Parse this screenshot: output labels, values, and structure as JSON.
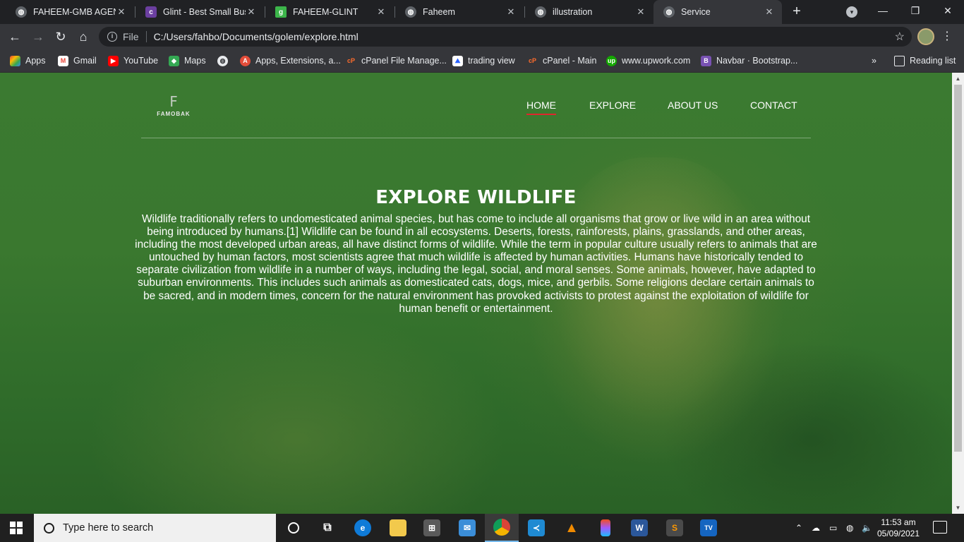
{
  "browser": {
    "tabs": [
      {
        "title": "FAHEEM-GMB AGENCY",
        "fav_color": "#5f6368",
        "fav_glyph": ""
      },
      {
        "title": "Glint - Best Small Business",
        "fav_color": "#6b3fa0",
        "fav_glyph": ""
      },
      {
        "title": "FAHEEM-GLINT",
        "fav_color": "#3cb54a",
        "fav_glyph": "g"
      },
      {
        "title": "Faheem",
        "fav_color": "#5f6368",
        "fav_glyph": ""
      },
      {
        "title": "illustration",
        "fav_color": "#5f6368",
        "fav_glyph": ""
      },
      {
        "title": "Service",
        "fav_color": "#5f6368",
        "fav_glyph": ""
      }
    ],
    "active_tab": 5,
    "address": {
      "scheme_label": "File",
      "url": "C:/Users/fahbo/Documents/golem/explore.html"
    },
    "bookmarks": [
      {
        "label": "Apps",
        "icon": "apps-grid-icon",
        "color": "#e94235"
      },
      {
        "label": "Gmail",
        "icon": "gmail-icon",
        "color": "#ea4335"
      },
      {
        "label": "YouTube",
        "icon": "youtube-icon",
        "color": "#ff0000"
      },
      {
        "label": "Maps",
        "icon": "maps-icon",
        "color": "#34a853"
      },
      {
        "label": "",
        "icon": "globe-icon",
        "color": "#5f6368"
      },
      {
        "label": "Apps, Extensions, a...",
        "icon": "extensions-icon",
        "color": "#e44d3a"
      },
      {
        "label": "cPanel File Manage...",
        "icon": "cpanel-icon",
        "color": "#ff6c2c"
      },
      {
        "label": "trading view",
        "icon": "trading-view-icon",
        "color": "#2962ff"
      },
      {
        "label": "cPanel - Main",
        "icon": "cpanel-icon",
        "color": "#ff6c2c"
      },
      {
        "label": "www.upwork.com",
        "icon": "upwork-icon",
        "color": "#14a800"
      },
      {
        "label": "Navbar · Bootstrap...",
        "icon": "bootstrap-icon",
        "color": "#7952b3"
      }
    ],
    "reading_list": "Reading list"
  },
  "site": {
    "logo_mark": "F",
    "logo_text": "FAMOBAK",
    "nav": [
      {
        "label": "HOME",
        "active": true
      },
      {
        "label": "EXPLORE",
        "active": false
      },
      {
        "label": "ABOUT US",
        "active": false
      },
      {
        "label": "CONTACT",
        "active": false
      }
    ],
    "accent_color": "#e0252d",
    "overlay_color": "#3b7a31",
    "hero": {
      "title": "EXPLORE WILDLIFE",
      "text": "Wildlife traditionally refers to undomesticated animal species, but has come to include all organisms that grow or live wild in an area without being introduced by humans.[1] Wildlife can be found in all ecosystems. Deserts, forests, rainforests, plains, grasslands, and other areas, including the most developed urban areas, all have distinct forms of wildlife. While the term in popular culture usually refers to animals that are untouched by human factors, most scientists agree that much wildlife is affected by human activities. Humans have historically tended to separate civilization from wildlife in a number of ways, including the legal, social, and moral senses. Some animals, however, have adapted to suburban environments. This includes such animals as domesticated cats, dogs, mice, and gerbils. Some religions declare certain animals to be sacred, and in modern times, concern for the natural environment has provoked activists to protest against the exploitation of wildlife for human benefit or entertainment."
    }
  },
  "taskbar": {
    "search_placeholder": "Type here to search",
    "apps": [
      {
        "name": "cortana-icon",
        "color": "#202020"
      },
      {
        "name": "task-view-icon",
        "color": "#202020"
      },
      {
        "name": "edge-icon",
        "color": "#0f7bd8"
      },
      {
        "name": "file-explorer-icon",
        "color": "#f2c94c"
      },
      {
        "name": "store-icon",
        "color": "#5a5a5a"
      },
      {
        "name": "mail-icon",
        "color": "#3b8ed8"
      },
      {
        "name": "chrome-icon",
        "color": "#db4437"
      },
      {
        "name": "vscode-icon",
        "color": "#1f8ad2"
      },
      {
        "name": "vlc-icon",
        "color": "#f08a00"
      },
      {
        "name": "figma-icon",
        "color": "#a259ff"
      },
      {
        "name": "word-icon",
        "color": "#2b579a"
      },
      {
        "name": "sublime-icon",
        "color": "#ff9800"
      },
      {
        "name": "app-tv-icon",
        "color": "#1565c0"
      }
    ],
    "active_app": 6,
    "time": "11:53 am",
    "date": "05/09/2021"
  }
}
